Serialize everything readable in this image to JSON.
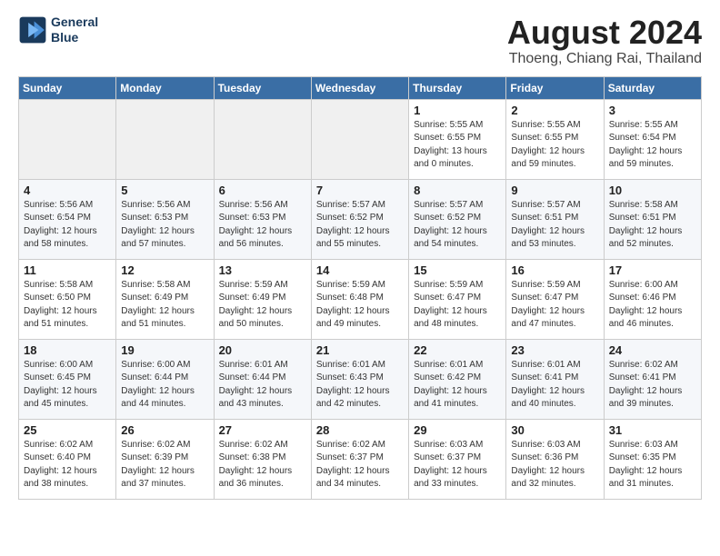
{
  "header": {
    "logo_line1": "General",
    "logo_line2": "Blue",
    "month_year": "August 2024",
    "location": "Thoeng, Chiang Rai, Thailand"
  },
  "weekdays": [
    "Sunday",
    "Monday",
    "Tuesday",
    "Wednesday",
    "Thursday",
    "Friday",
    "Saturday"
  ],
  "weeks": [
    [
      {
        "day": "",
        "info": ""
      },
      {
        "day": "",
        "info": ""
      },
      {
        "day": "",
        "info": ""
      },
      {
        "day": "",
        "info": ""
      },
      {
        "day": "1",
        "info": "Sunrise: 5:55 AM\nSunset: 6:55 PM\nDaylight: 13 hours\nand 0 minutes."
      },
      {
        "day": "2",
        "info": "Sunrise: 5:55 AM\nSunset: 6:55 PM\nDaylight: 12 hours\nand 59 minutes."
      },
      {
        "day": "3",
        "info": "Sunrise: 5:55 AM\nSunset: 6:54 PM\nDaylight: 12 hours\nand 59 minutes."
      }
    ],
    [
      {
        "day": "4",
        "info": "Sunrise: 5:56 AM\nSunset: 6:54 PM\nDaylight: 12 hours\nand 58 minutes."
      },
      {
        "day": "5",
        "info": "Sunrise: 5:56 AM\nSunset: 6:53 PM\nDaylight: 12 hours\nand 57 minutes."
      },
      {
        "day": "6",
        "info": "Sunrise: 5:56 AM\nSunset: 6:53 PM\nDaylight: 12 hours\nand 56 minutes."
      },
      {
        "day": "7",
        "info": "Sunrise: 5:57 AM\nSunset: 6:52 PM\nDaylight: 12 hours\nand 55 minutes."
      },
      {
        "day": "8",
        "info": "Sunrise: 5:57 AM\nSunset: 6:52 PM\nDaylight: 12 hours\nand 54 minutes."
      },
      {
        "day": "9",
        "info": "Sunrise: 5:57 AM\nSunset: 6:51 PM\nDaylight: 12 hours\nand 53 minutes."
      },
      {
        "day": "10",
        "info": "Sunrise: 5:58 AM\nSunset: 6:51 PM\nDaylight: 12 hours\nand 52 minutes."
      }
    ],
    [
      {
        "day": "11",
        "info": "Sunrise: 5:58 AM\nSunset: 6:50 PM\nDaylight: 12 hours\nand 51 minutes."
      },
      {
        "day": "12",
        "info": "Sunrise: 5:58 AM\nSunset: 6:49 PM\nDaylight: 12 hours\nand 51 minutes."
      },
      {
        "day": "13",
        "info": "Sunrise: 5:59 AM\nSunset: 6:49 PM\nDaylight: 12 hours\nand 50 minutes."
      },
      {
        "day": "14",
        "info": "Sunrise: 5:59 AM\nSunset: 6:48 PM\nDaylight: 12 hours\nand 49 minutes."
      },
      {
        "day": "15",
        "info": "Sunrise: 5:59 AM\nSunset: 6:47 PM\nDaylight: 12 hours\nand 48 minutes."
      },
      {
        "day": "16",
        "info": "Sunrise: 5:59 AM\nSunset: 6:47 PM\nDaylight: 12 hours\nand 47 minutes."
      },
      {
        "day": "17",
        "info": "Sunrise: 6:00 AM\nSunset: 6:46 PM\nDaylight: 12 hours\nand 46 minutes."
      }
    ],
    [
      {
        "day": "18",
        "info": "Sunrise: 6:00 AM\nSunset: 6:45 PM\nDaylight: 12 hours\nand 45 minutes."
      },
      {
        "day": "19",
        "info": "Sunrise: 6:00 AM\nSunset: 6:44 PM\nDaylight: 12 hours\nand 44 minutes."
      },
      {
        "day": "20",
        "info": "Sunrise: 6:01 AM\nSunset: 6:44 PM\nDaylight: 12 hours\nand 43 minutes."
      },
      {
        "day": "21",
        "info": "Sunrise: 6:01 AM\nSunset: 6:43 PM\nDaylight: 12 hours\nand 42 minutes."
      },
      {
        "day": "22",
        "info": "Sunrise: 6:01 AM\nSunset: 6:42 PM\nDaylight: 12 hours\nand 41 minutes."
      },
      {
        "day": "23",
        "info": "Sunrise: 6:01 AM\nSunset: 6:41 PM\nDaylight: 12 hours\nand 40 minutes."
      },
      {
        "day": "24",
        "info": "Sunrise: 6:02 AM\nSunset: 6:41 PM\nDaylight: 12 hours\nand 39 minutes."
      }
    ],
    [
      {
        "day": "25",
        "info": "Sunrise: 6:02 AM\nSunset: 6:40 PM\nDaylight: 12 hours\nand 38 minutes."
      },
      {
        "day": "26",
        "info": "Sunrise: 6:02 AM\nSunset: 6:39 PM\nDaylight: 12 hours\nand 37 minutes."
      },
      {
        "day": "27",
        "info": "Sunrise: 6:02 AM\nSunset: 6:38 PM\nDaylight: 12 hours\nand 36 minutes."
      },
      {
        "day": "28",
        "info": "Sunrise: 6:02 AM\nSunset: 6:37 PM\nDaylight: 12 hours\nand 34 minutes."
      },
      {
        "day": "29",
        "info": "Sunrise: 6:03 AM\nSunset: 6:37 PM\nDaylight: 12 hours\nand 33 minutes."
      },
      {
        "day": "30",
        "info": "Sunrise: 6:03 AM\nSunset: 6:36 PM\nDaylight: 12 hours\nand 32 minutes."
      },
      {
        "day": "31",
        "info": "Sunrise: 6:03 AM\nSunset: 6:35 PM\nDaylight: 12 hours\nand 31 minutes."
      }
    ]
  ]
}
